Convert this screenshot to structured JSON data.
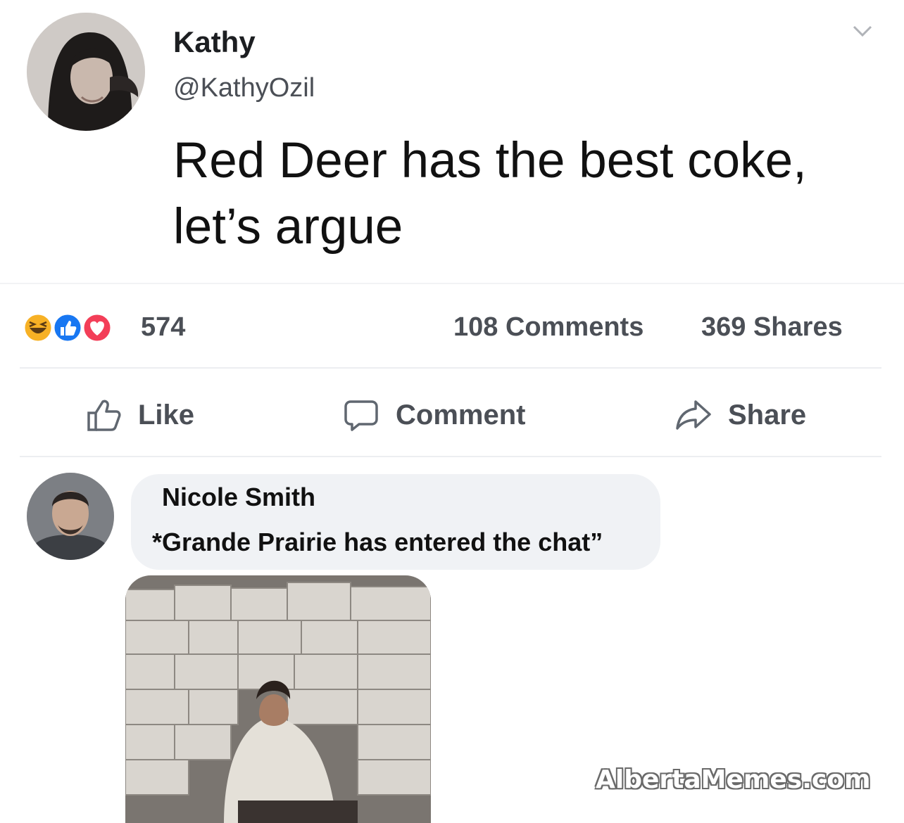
{
  "post": {
    "author": "Kathy",
    "handle": "@KathyOzil",
    "text": "Red Deer has the best coke, let’s argue",
    "menu_icon": "chevron-down-icon"
  },
  "stats": {
    "reactions": [
      "haha-reaction-icon",
      "like-reaction-icon",
      "love-reaction-icon"
    ],
    "reaction_count": "574",
    "comments": "108 Comments",
    "shares": "369 Shares"
  },
  "actions": {
    "like": {
      "label": "Like",
      "icon": "thumbs-up-icon"
    },
    "comment": {
      "label": "Comment",
      "icon": "speech-bubble-icon"
    },
    "share": {
      "label": "Share",
      "icon": "share-arrow-icon"
    }
  },
  "comment": {
    "author": "Nicole Smith",
    "text": "*Grande Prairie has entered the chat”"
  },
  "watermark": "AlbertaMemes.com",
  "colors": {
    "text_primary": "#1c1e21",
    "text_secondary": "#4b4f56",
    "comment_bubble": "#f0f2f5",
    "like_blue": "#1877f2",
    "love_red": "#f33e58",
    "haha_yellow": "#f7b125"
  }
}
